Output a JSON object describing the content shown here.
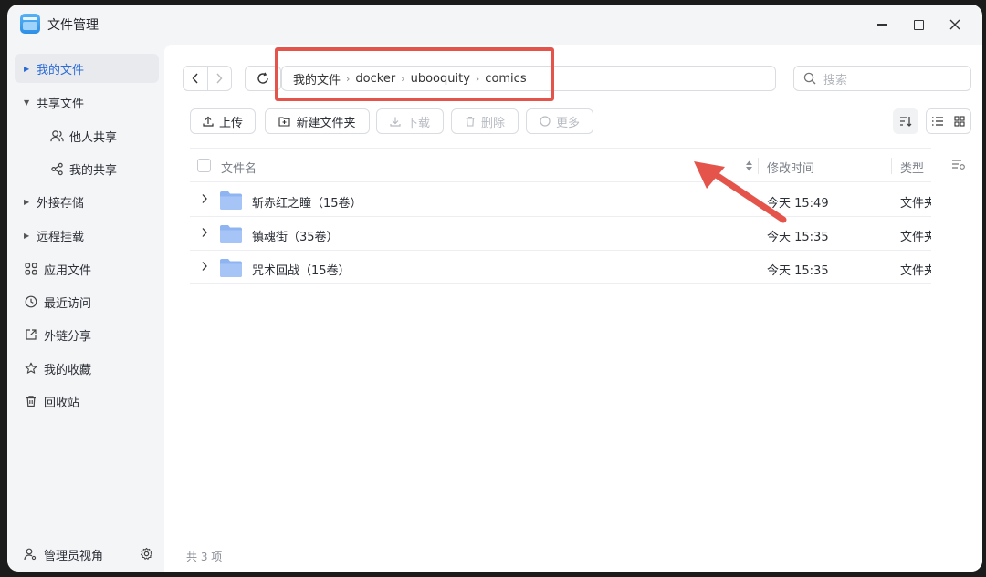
{
  "app": {
    "title": "文件管理"
  },
  "sidebar": {
    "items": [
      {
        "label": "我的文件",
        "icon": "caret-right-icon"
      },
      {
        "label": "共享文件",
        "icon": "caret-down-icon"
      },
      {
        "label": "他人共享",
        "icon": "users-icon"
      },
      {
        "label": "我的共享",
        "icon": "share-icon"
      },
      {
        "label": "外接存储",
        "icon": "caret-right-icon"
      },
      {
        "label": "远程挂载",
        "icon": "caret-right-icon"
      },
      {
        "label": "应用文件",
        "icon": "apps-icon"
      },
      {
        "label": "最近访问",
        "icon": "clock-icon"
      },
      {
        "label": "外链分享",
        "icon": "external-share-icon"
      },
      {
        "label": "我的收藏",
        "icon": "star-icon"
      },
      {
        "label": "回收站",
        "icon": "trash-icon"
      }
    ],
    "admin_label": "管理员视角"
  },
  "path": {
    "crumbs": [
      "我的文件",
      "docker",
      "ubooquity",
      "comics"
    ]
  },
  "search": {
    "placeholder": "搜索"
  },
  "toolbar": {
    "upload": "上传",
    "new_folder": "新建文件夹",
    "download": "下载",
    "delete": "删除",
    "more": "更多"
  },
  "table": {
    "columns": {
      "name": "文件名",
      "modified": "修改时间",
      "type": "类型"
    },
    "rows": [
      {
        "name": "斩赤红之瞳（15卷）",
        "modified": "今天 15:49",
        "type": "文件夹"
      },
      {
        "name": "镇魂街（35卷）",
        "modified": "今天 15:35",
        "type": "文件夹"
      },
      {
        "name": "咒术回战（15卷）",
        "modified": "今天 15:35",
        "type": "文件夹"
      }
    ]
  },
  "footer": {
    "count": "共 3 项"
  },
  "colors": {
    "accent": "#2b6bd6",
    "annotation": "#e4544b",
    "folder": "#8fb4f2"
  }
}
